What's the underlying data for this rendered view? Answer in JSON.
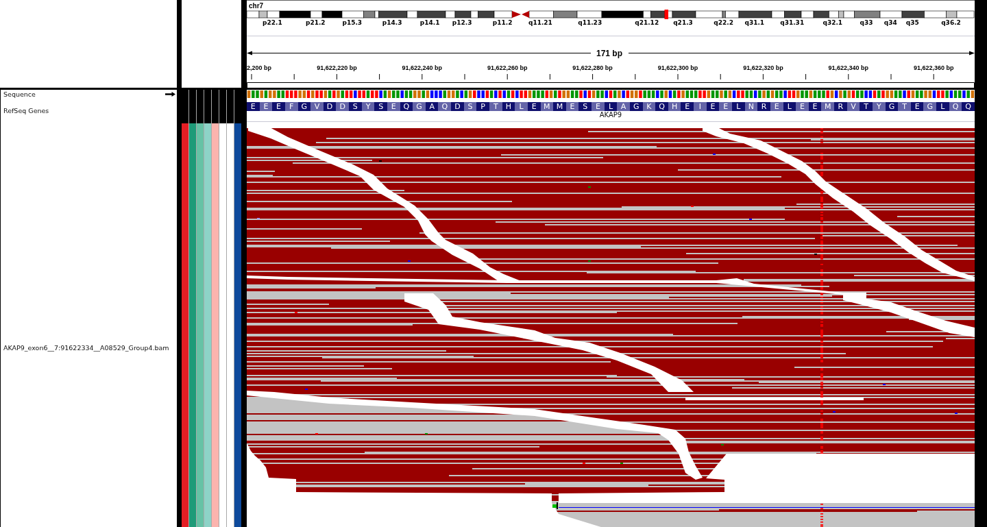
{
  "header": {
    "chromosome": "chr7",
    "cytobands": [
      "p22.1",
      "p21.2",
      "p15.3",
      "p14.3",
      "p14.1",
      "p12.3",
      "p11.2",
      "q11.21",
      "q11.23",
      "q21.12",
      "q21.3",
      "q22.2",
      "q31.1",
      "q31.31",
      "q32.1",
      "q33",
      "q34",
      "q35",
      "q36.2"
    ],
    "ruler": {
      "span": "171 bp",
      "ticks": [
        "2,200 bp",
        "91,622,220 bp",
        "91,622,240 bp",
        "91,622,260 bp",
        "91,622,280 bp",
        "91,622,300 bp",
        "91,622,320 bp",
        "91,622,340 bp",
        "91,622,360 bp"
      ]
    }
  },
  "tracks": [
    {
      "kind": "sequence",
      "name": "Sequence",
      "bases": [
        {
          "color": "#d17105"
        },
        {
          "color": "#009600"
        },
        {
          "color": "#009600"
        },
        {
          "color": "#d17105"
        },
        {
          "color": "#009600"
        },
        {
          "color": "#d17105"
        },
        {
          "color": "#d17105"
        },
        {
          "color": "#009600"
        },
        {
          "color": "#009600"
        },
        {
          "color": "#ff0000"
        },
        {
          "color": "#ff0000"
        },
        {
          "color": "#ff0000"
        },
        {
          "color": "#d17105"
        },
        {
          "color": "#d17105"
        },
        {
          "color": "#ff0000"
        },
        {
          "color": "#d17105"
        },
        {
          "color": "#ff0000"
        },
        {
          "color": "#ff0000"
        },
        {
          "color": "#d17105"
        },
        {
          "color": "#009600"
        },
        {
          "color": "#ff0000"
        },
        {
          "color": "#d17105"
        },
        {
          "color": "#009600"
        },
        {
          "color": "#ff0000"
        },
        {
          "color": "#ff0000"
        },
        {
          "color": "#0000ff"
        },
        {
          "color": "#ff0000"
        },
        {
          "color": "#ff0000"
        },
        {
          "color": "#009600"
        },
        {
          "color": "#ff0000"
        },
        {
          "color": "#ff0000"
        },
        {
          "color": "#0000ff"
        },
        {
          "color": "#009600"
        },
        {
          "color": "#d17105"
        },
        {
          "color": "#009600"
        },
        {
          "color": "#009600"
        },
        {
          "color": "#0000ff"
        },
        {
          "color": "#009600"
        },
        {
          "color": "#009600"
        },
        {
          "color": "#d17105"
        },
        {
          "color": "#d17105"
        },
        {
          "color": "#009600"
        },
        {
          "color": "#d17105"
        },
        {
          "color": "#0000ff"
        },
        {
          "color": "#0000ff"
        },
        {
          "color": "#0000ff"
        },
        {
          "color": "#009600"
        },
        {
          "color": "#d17105"
        },
        {
          "color": "#d17105"
        },
        {
          "color": "#009600"
        },
        {
          "color": "#0000ff"
        },
        {
          "color": "#009600"
        },
        {
          "color": "#d17105"
        },
        {
          "color": "#ff0000"
        },
        {
          "color": "#0000ff"
        },
        {
          "color": "#0000ff"
        },
        {
          "color": "#ff0000"
        },
        {
          "color": "#009600"
        },
        {
          "color": "#0000ff"
        },
        {
          "color": "#ff0000"
        },
        {
          "color": "#0000ff"
        },
        {
          "color": "#009600"
        },
        {
          "color": "#ff0000"
        },
        {
          "color": "#0000ff"
        },
        {
          "color": "#ff0000"
        },
        {
          "color": "#ff0000"
        },
        {
          "color": "#d17105"
        },
        {
          "color": "#009600"
        },
        {
          "color": "#009600"
        },
        {
          "color": "#009600"
        },
        {
          "color": "#ff0000"
        },
        {
          "color": "#d17105"
        },
        {
          "color": "#009600"
        },
        {
          "color": "#ff0000"
        },
        {
          "color": "#d17105"
        },
        {
          "color": "#d17105"
        },
        {
          "color": "#009600"
        },
        {
          "color": "#009600"
        },
        {
          "color": "#ff0000"
        },
        {
          "color": "#0000ff"
        },
        {
          "color": "#ff0000"
        },
        {
          "color": "#d17105"
        },
        {
          "color": "#009600"
        },
        {
          "color": "#009600"
        },
        {
          "color": "#0000ff"
        },
        {
          "color": "#ff0000"
        },
        {
          "color": "#009600"
        },
        {
          "color": "#d17105"
        },
        {
          "color": "#0000ff"
        },
        {
          "color": "#ff0000"
        },
        {
          "color": "#d17105"
        },
        {
          "color": "#d17105"
        },
        {
          "color": "#ff0000"
        },
        {
          "color": "#009600"
        },
        {
          "color": "#009600"
        },
        {
          "color": "#009600"
        },
        {
          "color": "#0000ff"
        },
        {
          "color": "#009600"
        },
        {
          "color": "#d17105"
        },
        {
          "color": "#0000ff"
        },
        {
          "color": "#009600"
        },
        {
          "color": "#ff0000"
        },
        {
          "color": "#d17105"
        },
        {
          "color": "#009600"
        },
        {
          "color": "#009600"
        },
        {
          "color": "#009600"
        },
        {
          "color": "#ff0000"
        },
        {
          "color": "#ff0000"
        },
        {
          "color": "#d17105"
        },
        {
          "color": "#009600"
        },
        {
          "color": "#009600"
        },
        {
          "color": "#d17105"
        },
        {
          "color": "#009600"
        },
        {
          "color": "#d17105"
        },
        {
          "color": "#0000ff"
        },
        {
          "color": "#ff0000"
        },
        {
          "color": "#ff0000"
        },
        {
          "color": "#009600"
        },
        {
          "color": "#009600"
        },
        {
          "color": "#0000ff"
        },
        {
          "color": "#009600"
        },
        {
          "color": "#d17105"
        },
        {
          "color": "#009600"
        },
        {
          "color": "#d17105"
        },
        {
          "color": "#009600"
        },
        {
          "color": "#009600"
        },
        {
          "color": "#0000ff"
        },
        {
          "color": "#ff0000"
        },
        {
          "color": "#ff0000"
        },
        {
          "color": "#d17105"
        },
        {
          "color": "#009600"
        },
        {
          "color": "#009600"
        },
        {
          "color": "#d17105"
        },
        {
          "color": "#009600"
        },
        {
          "color": "#009600"
        },
        {
          "color": "#009600"
        },
        {
          "color": "#ff0000"
        },
        {
          "color": "#d17105"
        },
        {
          "color": "#0000ff"
        },
        {
          "color": "#d17105"
        },
        {
          "color": "#009600"
        },
        {
          "color": "#d17105"
        },
        {
          "color": "#ff0000"
        },
        {
          "color": "#009600"
        },
        {
          "color": "#009600"
        },
        {
          "color": "#0000ff"
        },
        {
          "color": "#0000ff"
        },
        {
          "color": "#ff0000"
        },
        {
          "color": "#009600"
        },
        {
          "color": "#ff0000"
        },
        {
          "color": "#d17105"
        },
        {
          "color": "#d17105"
        },
        {
          "color": "#009600"
        },
        {
          "color": "#009600"
        },
        {
          "color": "#0000ff"
        },
        {
          "color": "#ff0000"
        },
        {
          "color": "#d17105"
        },
        {
          "color": "#009600"
        },
        {
          "color": "#009600"
        },
        {
          "color": "#d17105"
        },
        {
          "color": "#d17105"
        },
        {
          "color": "#0000ff"
        },
        {
          "color": "#ff0000"
        },
        {
          "color": "#ff0000"
        },
        {
          "color": "#009600"
        },
        {
          "color": "#0000ff"
        },
        {
          "color": "#009600"
        },
        {
          "color": "#009600"
        },
        {
          "color": "#0000ff"
        },
        {
          "color": "#009600"
        },
        {
          "color": "#d17105"
        }
      ]
    },
    {
      "kind": "gene",
      "name": "RefSeq Genes",
      "gene": "AKAP9",
      "amino_acids": [
        "E",
        "E",
        "E",
        "F",
        "G",
        "V",
        "D",
        "D",
        "S",
        "Y",
        "S",
        "E",
        "Q",
        "G",
        "A",
        "Q",
        "D",
        "S",
        "P",
        "T",
        "H",
        "L",
        "E",
        "M",
        "M",
        "E",
        "S",
        "E",
        "L",
        "A",
        "G",
        "K",
        "Q",
        "H",
        "E",
        "I",
        "E",
        "E",
        "L",
        "N",
        "R",
        "E",
        "L",
        "E",
        "E",
        "M",
        "R",
        "V",
        "T",
        "Y",
        "G",
        "T",
        "E",
        "G",
        "L",
        "Q",
        "Q"
      ]
    },
    {
      "kind": "alignment",
      "name": "AKAP9_exon6__7:91622334__A08529_Group4.bam",
      "attributes": [
        {
          "color": "#e41e24"
        },
        {
          "color": "#1e9b78"
        },
        {
          "color": "#66c2a5"
        },
        {
          "color": "#8dd3c7"
        },
        {
          "color": "#fbb4ae"
        },
        {
          "color": "#ffffff"
        },
        {
          "color": "#ffffff"
        },
        {
          "color": "#0e4a9c"
        }
      ]
    }
  ]
}
